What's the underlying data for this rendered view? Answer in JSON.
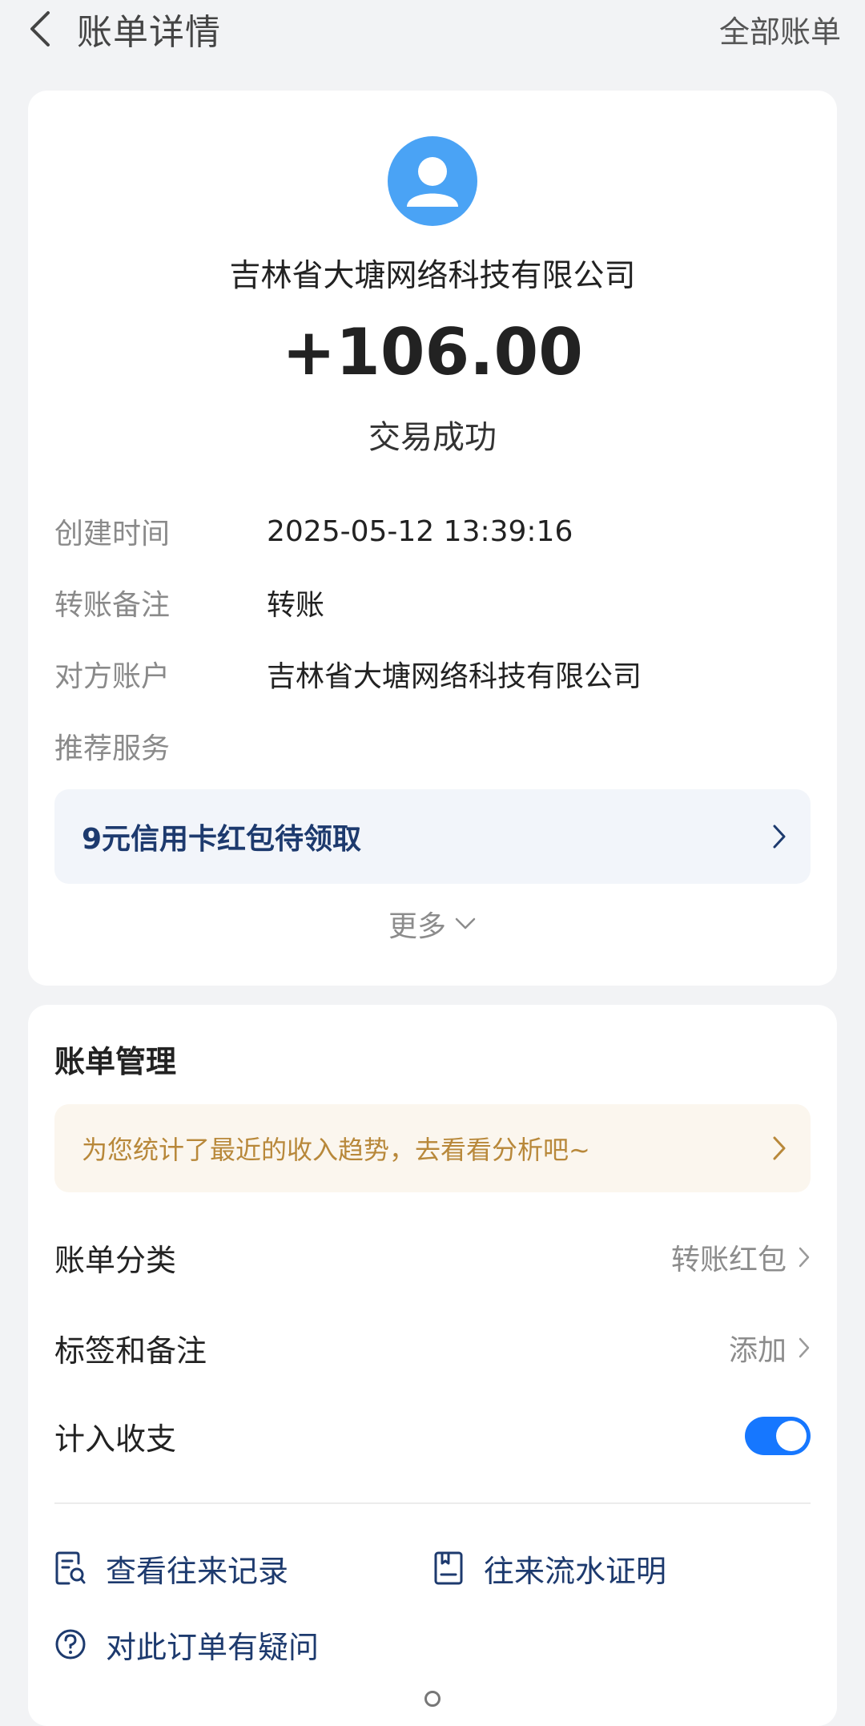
{
  "header": {
    "title": "账单详情",
    "right_link": "全部账单"
  },
  "transaction": {
    "payee": "吉林省大塘网络科技有限公司",
    "amount": "+106.00",
    "status": "交易成功"
  },
  "details": [
    {
      "label": "创建时间",
      "value": "2025-05-12 13:39:16"
    },
    {
      "label": "转账备注",
      "value": "转账"
    },
    {
      "label": "对方账户",
      "value": "吉林省大塘网络科技有限公司"
    },
    {
      "label": "推荐服务",
      "value": ""
    }
  ],
  "promo": {
    "text": "9元信用卡红包待领取"
  },
  "more": {
    "label": "更多"
  },
  "management": {
    "title": "账单管理",
    "tip": "为您统计了最近的收入趋势，去看看分析吧~",
    "rows": [
      {
        "label": "账单分类",
        "value": "转账红包"
      },
      {
        "label": "标签和备注",
        "value": "添加"
      },
      {
        "label": "计入收支",
        "toggle_on": true
      }
    ],
    "actions": [
      {
        "label": "查看往来记录",
        "icon": "record-search-icon"
      },
      {
        "label": "往来流水证明",
        "icon": "statement-icon"
      },
      {
        "label": "对此订单有疑问",
        "icon": "question-icon"
      }
    ]
  },
  "colors": {
    "accent": "#1677ff",
    "avatar": "#4aa3f5",
    "link_text": "#1d3a6e",
    "tip_text": "#b8883a"
  }
}
